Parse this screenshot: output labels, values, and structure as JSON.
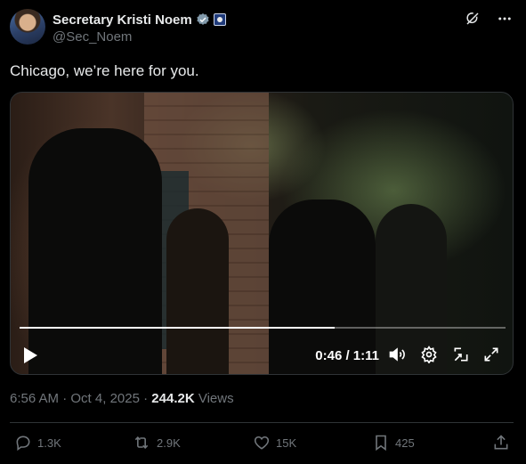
{
  "author": {
    "display_name": "Secretary Kristi Noem",
    "handle": "@Sec_Noem",
    "verified_icon": "verified-badge-icon",
    "affiliation_icon": "dhs-seal-icon"
  },
  "header_icons": [
    "grok-icon",
    "more-icon"
  ],
  "tweet": {
    "text": "Chicago, we’re here for you."
  },
  "video": {
    "time": "0:46 / 1:11",
    "progress": 0.648,
    "controls": [
      "play-icon",
      "volume-icon",
      "settings-icon",
      "pip-icon",
      "fullscreen-icon"
    ]
  },
  "meta": {
    "time": "6:56 AM",
    "sep": "·",
    "date": "Oct 4, 2025",
    "views_count": "244.2K",
    "views_label": "Views"
  },
  "actions": {
    "replies": "1.3K",
    "reposts": "2.9K",
    "likes": "15K",
    "bookmarks": "425"
  },
  "colors": {
    "background": "#000000",
    "text": "#e7e9ea",
    "muted": "#71767b",
    "border": "#2f3336",
    "verified": "#829aab"
  }
}
